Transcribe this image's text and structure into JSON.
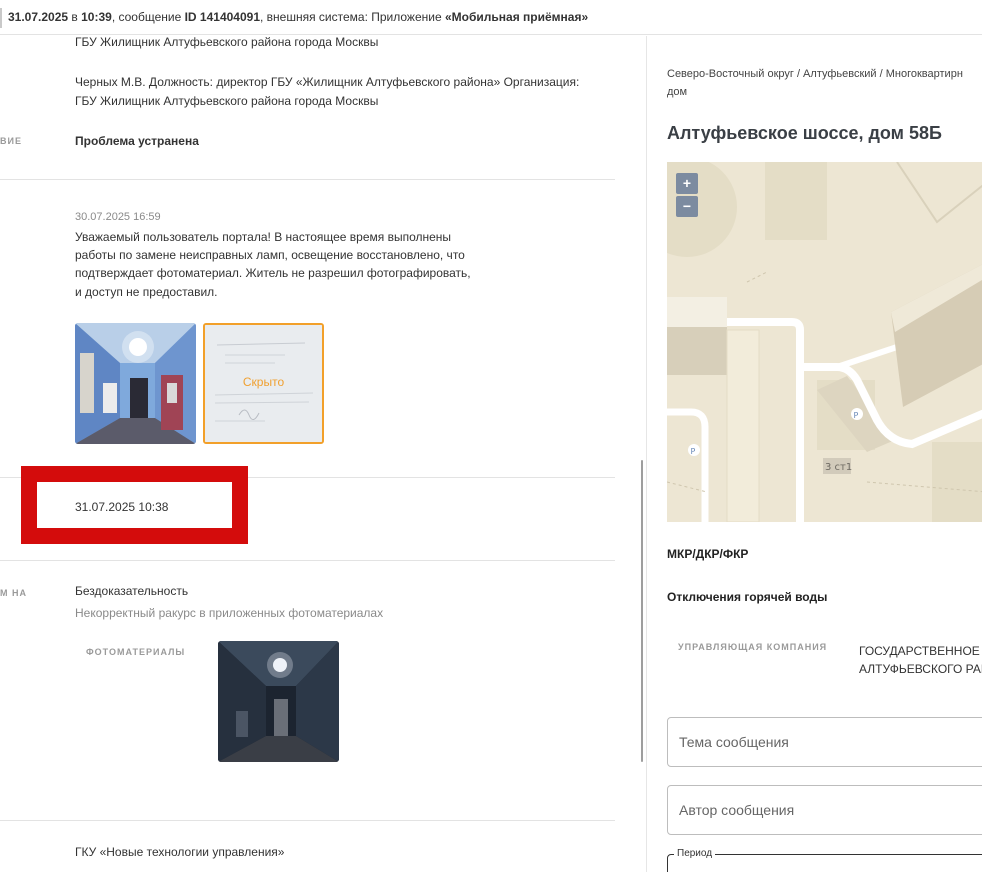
{
  "header": {
    "datetime": "31.07.2025",
    "in_word": " в ",
    "time": "10:39",
    "message_prefix": ", сообщение ",
    "message_id": "ID 141404091",
    "system_prefix": ", внешняя система: Приложение ",
    "system_name": "«Мобильная приёмная»"
  },
  "history": {
    "entry1": {
      "org_line_cut": "ГБУ Жилищник Алтуфьевского района города Москвы",
      "person_line1": "Черных М.В. Должность: директор ГБУ «Жилищник Алтуфьевского района» Организация:",
      "person_line2": "ГБУ Жилищник Алтуфьевского района города Москвы",
      "status_label_cut": "ВИЕ",
      "status_value": "Проблема устранена"
    },
    "entry2": {
      "timestamp": "30.07.2025 16:59",
      "text_lines": [
        "Уважаемый пользователь портала! В настоящее время выполнены",
        "работы по замене неисправных ламп, освещение восстановлено, что",
        "подтверждает фотоматериал. Житель не разрешил фотографировать,",
        "и доступ не предоставил."
      ],
      "hidden_label": "Скрыто"
    },
    "entry3": {
      "timestamp": "31.07.2025 10:38"
    },
    "entry4": {
      "label_cut": "М НА",
      "reason": "Бездоказательность",
      "reason_detail": "Некорректный ракурс в приложенных фотоматериалах",
      "photos_label": "ФОТОМАТЕРИАЛЫ"
    },
    "entry5": {
      "org": "ГКУ «Новые технологии управления»"
    }
  },
  "sidebar": {
    "breadcrumb_line1": "Северо-Восточный округ / Алтуфьевский / Многоквартирн",
    "breadcrumb_line2": "дом",
    "address": "Алтуфьевское шоссе, дом 58Б",
    "map": {
      "zoom_in": "+",
      "zoom_out": "−",
      "building_label": "3 ст1",
      "parking_label": "P"
    },
    "section1": "МКР/ДКР/ФКР",
    "section2": "Отключения горячей воды",
    "company_label": "УПРАВЛЯЮЩАЯ КОМПАНИЯ",
    "company_line1": "ГОСУДАРСТВЕННОЕ Б",
    "company_line2": "АЛТУФЬЕВСКОГО РАЙ",
    "topic_placeholder": "Тема сообщения",
    "author_placeholder": "Автор сообщения",
    "period_label": "Период"
  }
}
